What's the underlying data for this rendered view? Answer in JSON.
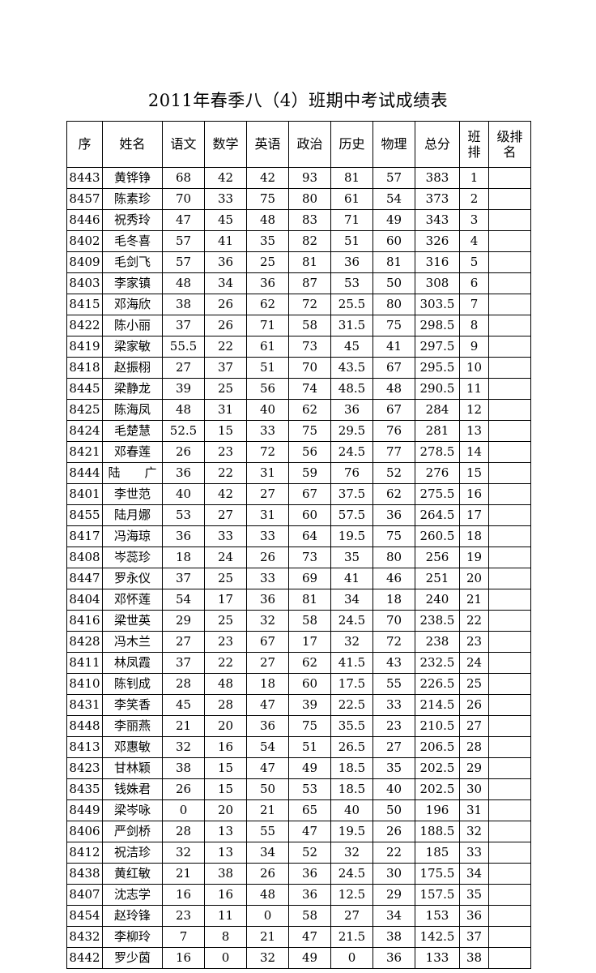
{
  "document": {
    "title": "2011年春季八（4）班期中考试成绩表"
  },
  "table": {
    "headers": [
      {
        "key": "seq",
        "label": "序",
        "lines": [
          "序"
        ]
      },
      {
        "key": "name",
        "label": "姓名",
        "lines": [
          "姓名"
        ]
      },
      {
        "key": "chn",
        "label": "语文",
        "lines": [
          "语文"
        ]
      },
      {
        "key": "math",
        "label": "数学",
        "lines": [
          "数学"
        ]
      },
      {
        "key": "eng",
        "label": "英语",
        "lines": [
          "英语"
        ]
      },
      {
        "key": "pol",
        "label": "政治",
        "lines": [
          "政治"
        ]
      },
      {
        "key": "his",
        "label": "历史",
        "lines": [
          "历史"
        ]
      },
      {
        "key": "phy",
        "label": "物理",
        "lines": [
          "物理"
        ]
      },
      {
        "key": "total",
        "label": "总分",
        "lines": [
          "总分"
        ]
      },
      {
        "key": "crank",
        "label": "班排",
        "lines": [
          "班",
          "排"
        ]
      },
      {
        "key": "grank",
        "label": "级排名",
        "lines": [
          "级排",
          "名"
        ]
      }
    ],
    "rows": [
      {
        "seq": "8443",
        "name": "黄铧铮",
        "chn": "68",
        "math": "42",
        "eng": "42",
        "pol": "93",
        "his": "81",
        "phy": "57",
        "total": "383",
        "crank": "1",
        "grank": ""
      },
      {
        "seq": "8457",
        "name": "陈素珍",
        "chn": "70",
        "math": "33",
        "eng": "75",
        "pol": "80",
        "his": "61",
        "phy": "54",
        "total": "373",
        "crank": "2",
        "grank": ""
      },
      {
        "seq": "8446",
        "name": "祝秀玲",
        "chn": "47",
        "math": "45",
        "eng": "48",
        "pol": "83",
        "his": "71",
        "phy": "49",
        "total": "343",
        "crank": "3",
        "grank": ""
      },
      {
        "seq": "8402",
        "name": "毛冬喜",
        "chn": "57",
        "math": "41",
        "eng": "35",
        "pol": "82",
        "his": "51",
        "phy": "60",
        "total": "326",
        "crank": "4",
        "grank": ""
      },
      {
        "seq": "8409",
        "name": "毛剑飞",
        "chn": "57",
        "math": "36",
        "eng": "25",
        "pol": "81",
        "his": "36",
        "phy": "81",
        "total": "316",
        "crank": "5",
        "grank": ""
      },
      {
        "seq": "8403",
        "name": "李家镇",
        "chn": "48",
        "math": "34",
        "eng": "36",
        "pol": "87",
        "his": "53",
        "phy": "50",
        "total": "308",
        "crank": "6",
        "grank": ""
      },
      {
        "seq": "8415",
        "name": "邓海欣",
        "chn": "38",
        "math": "26",
        "eng": "62",
        "pol": "72",
        "his": "25.5",
        "phy": "80",
        "total": "303.5",
        "crank": "7",
        "grank": ""
      },
      {
        "seq": "8422",
        "name": "陈小丽",
        "chn": "37",
        "math": "26",
        "eng": "71",
        "pol": "58",
        "his": "31.5",
        "phy": "75",
        "total": "298.5",
        "crank": "8",
        "grank": ""
      },
      {
        "seq": "8419",
        "name": "梁家敏",
        "chn": "55.5",
        "math": "22",
        "eng": "61",
        "pol": "73",
        "his": "45",
        "phy": "41",
        "total": "297.5",
        "crank": "9",
        "grank": ""
      },
      {
        "seq": "8418",
        "name": "赵振栩",
        "chn": "27",
        "math": "37",
        "eng": "51",
        "pol": "70",
        "his": "43.5",
        "phy": "67",
        "total": "295.5",
        "crank": "10",
        "grank": ""
      },
      {
        "seq": "8445",
        "name": "梁静龙",
        "chn": "39",
        "math": "25",
        "eng": "56",
        "pol": "74",
        "his": "48.5",
        "phy": "48",
        "total": "290.5",
        "crank": "11",
        "grank": ""
      },
      {
        "seq": "8425",
        "name": "陈海凤",
        "chn": "48",
        "math": "31",
        "eng": "40",
        "pol": "62",
        "his": "36",
        "phy": "67",
        "total": "284",
        "crank": "12",
        "grank": ""
      },
      {
        "seq": "8424",
        "name": "毛楚慧",
        "chn": "52.5",
        "math": "15",
        "eng": "33",
        "pol": "75",
        "his": "29.5",
        "phy": "76",
        "total": "281",
        "crank": "13",
        "grank": ""
      },
      {
        "seq": "8421",
        "name": "邓春莲",
        "chn": "26",
        "math": "23",
        "eng": "72",
        "pol": "56",
        "his": "24.5",
        "phy": "77",
        "total": "278.5",
        "crank": "14",
        "grank": ""
      },
      {
        "seq": "8444",
        "name": "陆　　广",
        "chn": "36",
        "math": "22",
        "eng": "31",
        "pol": "59",
        "his": "76",
        "phy": "52",
        "total": "276",
        "crank": "15",
        "grank": ""
      },
      {
        "seq": "8401",
        "name": "李世范",
        "chn": "40",
        "math": "42",
        "eng": "27",
        "pol": "67",
        "his": "37.5",
        "phy": "62",
        "total": "275.5",
        "crank": "16",
        "grank": ""
      },
      {
        "seq": "8455",
        "name": "陆月娜",
        "chn": "53",
        "math": "27",
        "eng": "31",
        "pol": "60",
        "his": "57.5",
        "phy": "36",
        "total": "264.5",
        "crank": "17",
        "grank": ""
      },
      {
        "seq": "8417",
        "name": "冯海琼",
        "chn": "36",
        "math": "33",
        "eng": "33",
        "pol": "64",
        "his": "19.5",
        "phy": "75",
        "total": "260.5",
        "crank": "18",
        "grank": ""
      },
      {
        "seq": "8408",
        "name": "岑蕊珍",
        "chn": "18",
        "math": "24",
        "eng": "26",
        "pol": "73",
        "his": "35",
        "phy": "80",
        "total": "256",
        "crank": "19",
        "grank": ""
      },
      {
        "seq": "8447",
        "name": "罗永仪",
        "chn": "37",
        "math": "25",
        "eng": "33",
        "pol": "69",
        "his": "41",
        "phy": "46",
        "total": "251",
        "crank": "20",
        "grank": ""
      },
      {
        "seq": "8404",
        "name": "邓怀莲",
        "chn": "54",
        "math": "17",
        "eng": "36",
        "pol": "81",
        "his": "34",
        "phy": "18",
        "total": "240",
        "crank": "21",
        "grank": ""
      },
      {
        "seq": "8416",
        "name": "梁世英",
        "chn": "29",
        "math": "25",
        "eng": "32",
        "pol": "58",
        "his": "24.5",
        "phy": "70",
        "total": "238.5",
        "crank": "22",
        "grank": ""
      },
      {
        "seq": "8428",
        "name": "冯木兰",
        "chn": "27",
        "math": "23",
        "eng": "67",
        "pol": "17",
        "his": "32",
        "phy": "72",
        "total": "238",
        "crank": "23",
        "grank": ""
      },
      {
        "seq": "8411",
        "name": "林凤霞",
        "chn": "37",
        "math": "22",
        "eng": "27",
        "pol": "62",
        "his": "41.5",
        "phy": "43",
        "total": "232.5",
        "crank": "24",
        "grank": ""
      },
      {
        "seq": "8410",
        "name": "陈钊成",
        "chn": "28",
        "math": "48",
        "eng": "18",
        "pol": "60",
        "his": "17.5",
        "phy": "55",
        "total": "226.5",
        "crank": "25",
        "grank": ""
      },
      {
        "seq": "8431",
        "name": "李笑香",
        "chn": "45",
        "math": "28",
        "eng": "47",
        "pol": "39",
        "his": "22.5",
        "phy": "33",
        "total": "214.5",
        "crank": "26",
        "grank": ""
      },
      {
        "seq": "8448",
        "name": "李丽燕",
        "chn": "21",
        "math": "20",
        "eng": "36",
        "pol": "75",
        "his": "35.5",
        "phy": "23",
        "total": "210.5",
        "crank": "27",
        "grank": ""
      },
      {
        "seq": "8413",
        "name": "邓惠敏",
        "chn": "32",
        "math": "16",
        "eng": "54",
        "pol": "51",
        "his": "26.5",
        "phy": "27",
        "total": "206.5",
        "crank": "28",
        "grank": ""
      },
      {
        "seq": "8423",
        "name": "甘林颖",
        "chn": "38",
        "math": "15",
        "eng": "47",
        "pol": "49",
        "his": "18.5",
        "phy": "35",
        "total": "202.5",
        "crank": "29",
        "grank": ""
      },
      {
        "seq": "8435",
        "name": "钱姝君",
        "chn": "26",
        "math": "15",
        "eng": "50",
        "pol": "53",
        "his": "18.5",
        "phy": "40",
        "total": "202.5",
        "crank": "30",
        "grank": ""
      },
      {
        "seq": "8449",
        "name": "梁岑咏",
        "chn": "0",
        "math": "20",
        "eng": "21",
        "pol": "65",
        "his": "40",
        "phy": "50",
        "total": "196",
        "crank": "31",
        "grank": ""
      },
      {
        "seq": "8406",
        "name": "严剑桥",
        "chn": "28",
        "math": "13",
        "eng": "55",
        "pol": "47",
        "his": "19.5",
        "phy": "26",
        "total": "188.5",
        "crank": "32",
        "grank": ""
      },
      {
        "seq": "8412",
        "name": "祝洁珍",
        "chn": "32",
        "math": "13",
        "eng": "34",
        "pol": "52",
        "his": "32",
        "phy": "22",
        "total": "185",
        "crank": "33",
        "grank": ""
      },
      {
        "seq": "8438",
        "name": "黄红敏",
        "chn": "21",
        "math": "38",
        "eng": "26",
        "pol": "36",
        "his": "24.5",
        "phy": "30",
        "total": "175.5",
        "crank": "34",
        "grank": ""
      },
      {
        "seq": "8407",
        "name": "沈志学",
        "chn": "16",
        "math": "16",
        "eng": "48",
        "pol": "36",
        "his": "12.5",
        "phy": "29",
        "total": "157.5",
        "crank": "35",
        "grank": ""
      },
      {
        "seq": "8454",
        "name": "赵玲锋",
        "chn": "23",
        "math": "11",
        "eng": "0",
        "pol": "58",
        "his": "27",
        "phy": "34",
        "total": "153",
        "crank": "36",
        "grank": ""
      },
      {
        "seq": "8432",
        "name": "李柳玲",
        "chn": "7",
        "math": "8",
        "eng": "21",
        "pol": "47",
        "his": "21.5",
        "phy": "38",
        "total": "142.5",
        "crank": "37",
        "grank": ""
      },
      {
        "seq": "8442",
        "name": "罗少茵",
        "chn": "16",
        "math": "0",
        "eng": "32",
        "pol": "49",
        "his": "0",
        "phy": "36",
        "total": "133",
        "crank": "38",
        "grank": ""
      }
    ]
  }
}
